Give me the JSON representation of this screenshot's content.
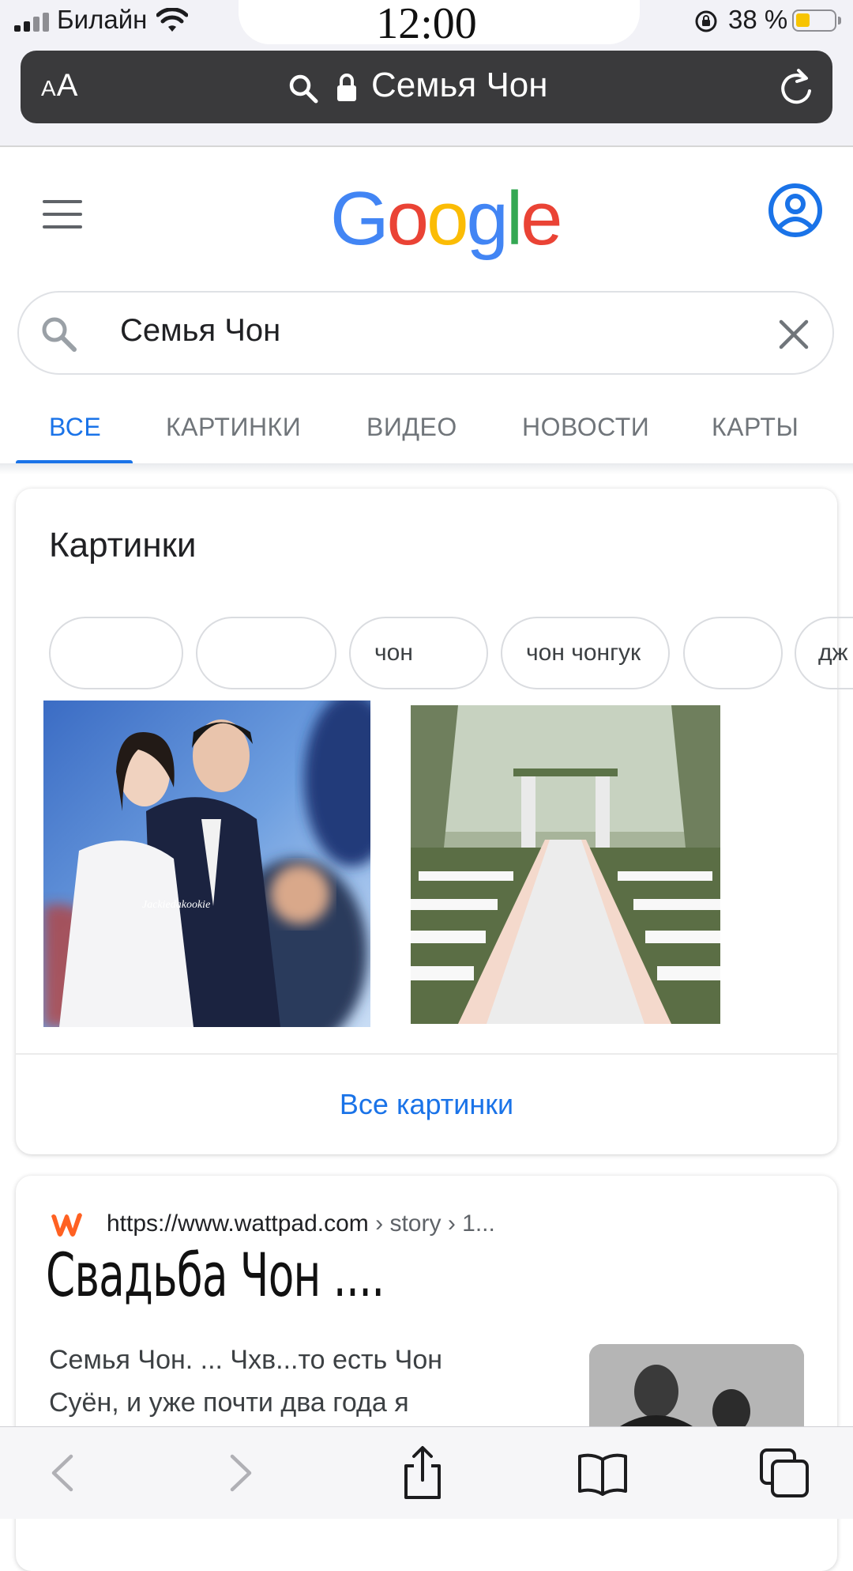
{
  "status_bar": {
    "carrier": "Билайн",
    "time": "12:00",
    "battery_percent": "38 %",
    "battery_color": "#f7c402"
  },
  "address_bar": {
    "text_size_label": "AA",
    "page_title": "Семья Чон",
    "icons": [
      "search-icon",
      "lock-icon",
      "reload-icon"
    ]
  },
  "google": {
    "logo_letters": [
      "G",
      "o",
      "o",
      "g",
      "l",
      "e"
    ],
    "logo_colors": [
      "#4285f4",
      "#ea4335",
      "#fbbc05",
      "#4285f4",
      "#34a853",
      "#ea4335"
    ]
  },
  "search": {
    "query": "Семья Чон"
  },
  "tabs": [
    {
      "label": "ВСЕ",
      "active": true
    },
    {
      "label": "КАРТИНКИ",
      "active": false
    },
    {
      "label": "ВИДЕО",
      "active": false
    },
    {
      "label": "НОВОСТИ",
      "active": false
    },
    {
      "label": "КАРТЫ",
      "active": false
    }
  ],
  "images_card": {
    "title": "Картинки",
    "chips": [
      "",
      "",
      "чон",
      "чон чонгук",
      "",
      "дж"
    ],
    "thumbnail_watermark": "Jackiedakookie",
    "all_images_link": "Все картинки"
  },
  "result": {
    "url": "https://www.wattpad.com",
    "breadcrumb": " › story › 1...",
    "title": "Свадьба Чон ....",
    "snippet_line1": "Семья Чон. ... Чхв...то есть Чон",
    "snippet_line2": "Суён, и уже почти два года я",
    "favicon_color": "#ff6122"
  },
  "toolbar": {
    "icons": [
      "back-icon",
      "forward-icon",
      "share-icon",
      "bookmarks-icon",
      "tabs-icon"
    ]
  },
  "accent_color": "#1a73e8"
}
